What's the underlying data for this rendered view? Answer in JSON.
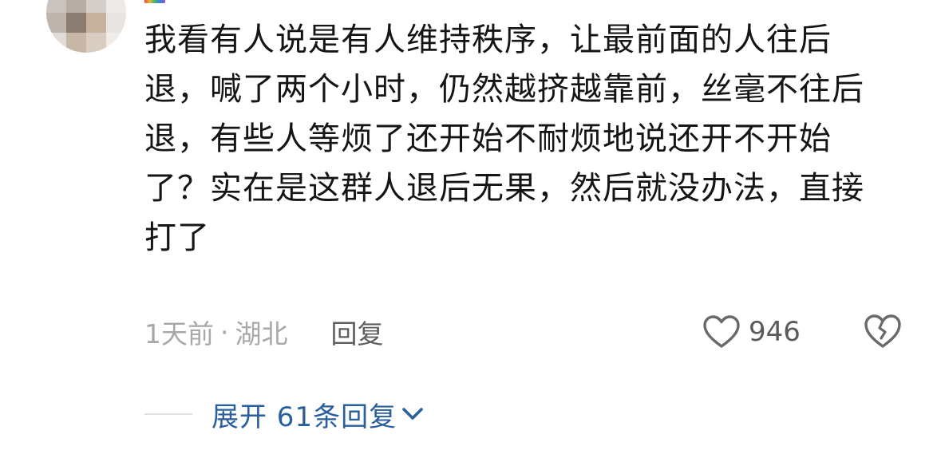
{
  "comment": {
    "text": "我看有人说是有人维持秩序，让最前面的人往后退，喊了两个小时，仍然越挤越靠前，丝毫不往后退，有些人等烦了还开始不耐烦地说还开不开始了？实在是这群人退后无果，然后就没办法，直接打了",
    "time": "1天前",
    "separator": "·",
    "location": "湖北",
    "reply_label": "回复",
    "like_count": "946"
  },
  "replies": {
    "expand_label": "展开 61条回复"
  },
  "icons": {
    "like": "heart-outline-icon",
    "dislike": "broken-heart-icon",
    "expand": "chevron-down-icon"
  },
  "colors": {
    "text": "#151515",
    "meta": "#a8a8a8",
    "reply": "#5e5e5e",
    "link": "#2a5f9e"
  }
}
